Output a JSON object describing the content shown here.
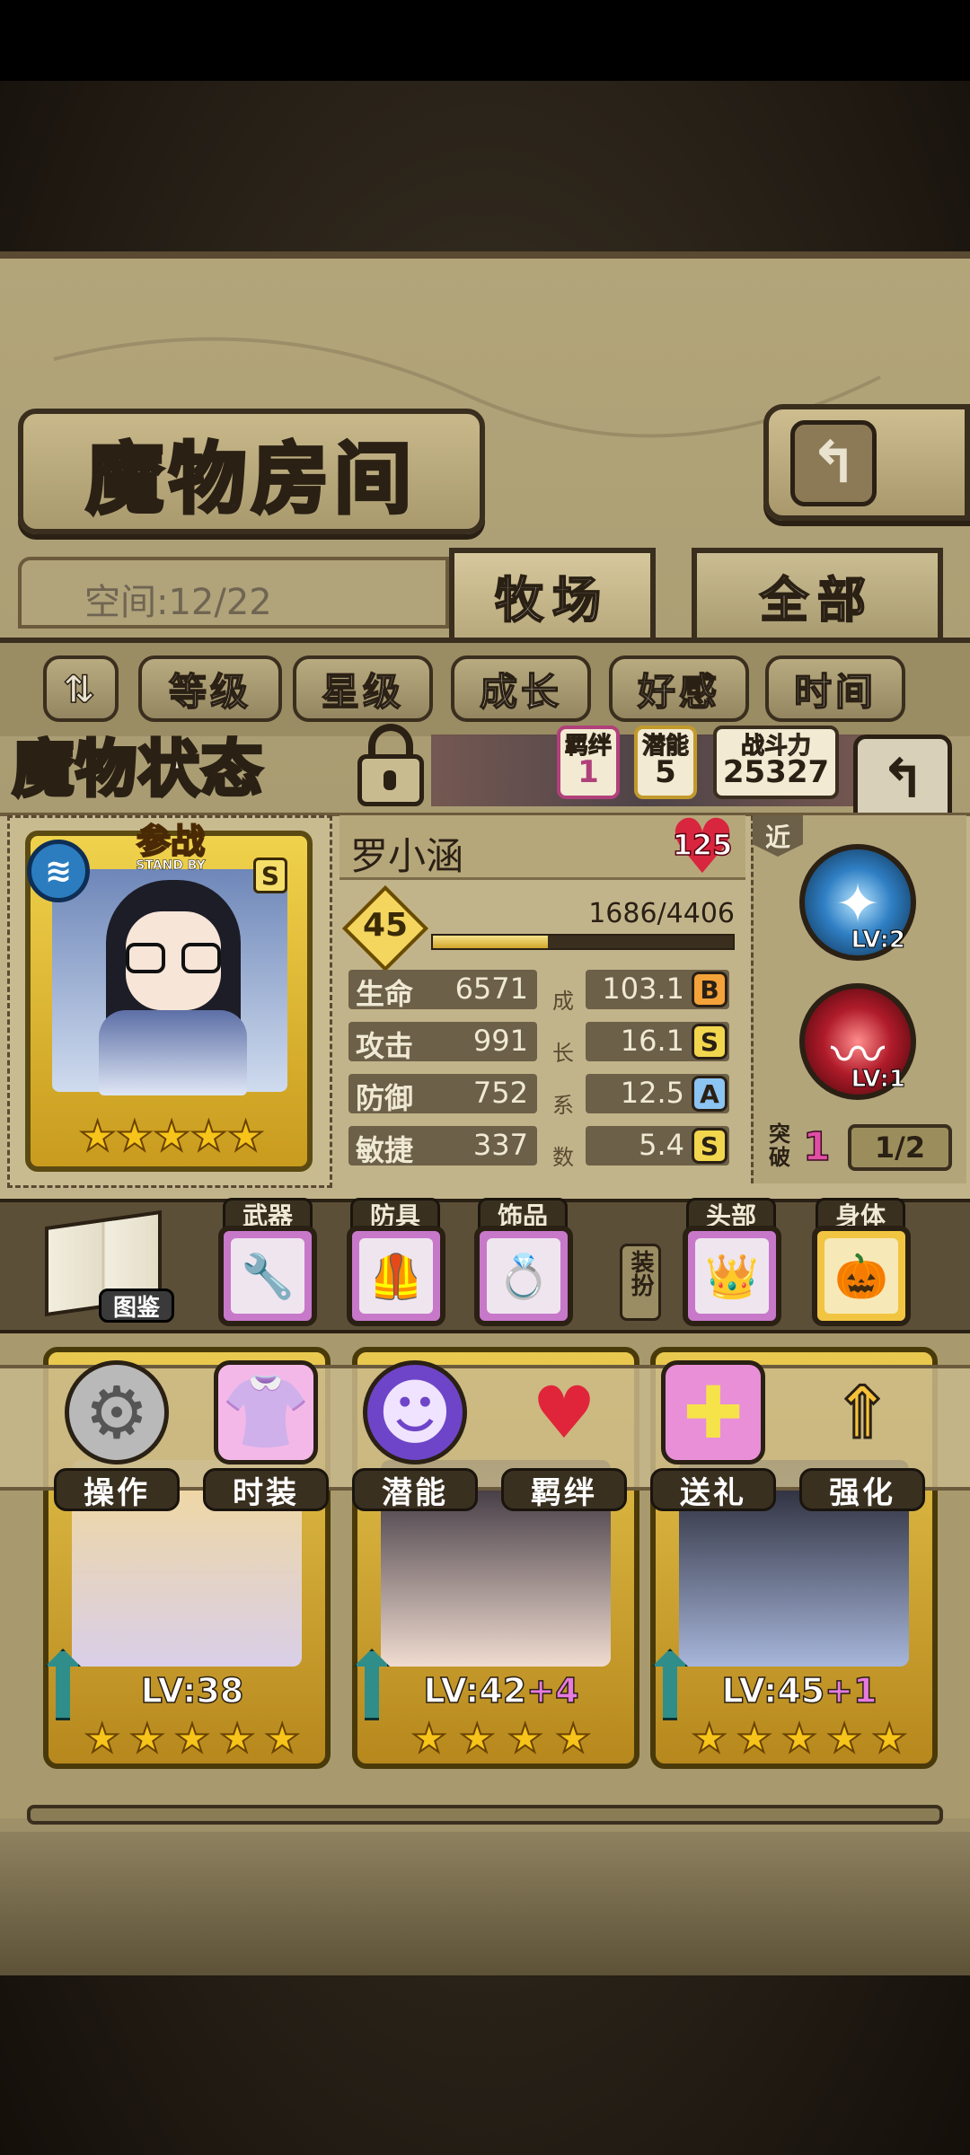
{
  "title": "魔物房间",
  "space": "空间:12/22",
  "tabs": [
    "牧场",
    "全部"
  ],
  "sort_buttons": [
    "等级",
    "星级",
    "成长",
    "好感",
    "时间"
  ],
  "status_title": "魔物状态",
  "mini_stats": {
    "bond": {
      "label": "羁绊",
      "value": "1"
    },
    "potential": {
      "label": "潜能",
      "value": "5"
    },
    "power": {
      "label": "战斗力",
      "value": "25327"
    }
  },
  "portrait": {
    "standby_cn": "参战",
    "standby_en": "STAND BY",
    "rank": "S",
    "stars": 5
  },
  "monster": {
    "name": "罗小涵",
    "affinity": "125",
    "level": "45",
    "exp_text": "1686/4406",
    "exp_ratio": 0.383
  },
  "stats": [
    {
      "label": "生命",
      "value": "6571",
      "growth": "103.1",
      "grade": "B"
    },
    {
      "label": "攻击",
      "value": "991",
      "growth": "16.1",
      "grade": "S"
    },
    {
      "label": "防御",
      "value": "752",
      "growth": "12.5",
      "grade": "A"
    },
    {
      "label": "敏捷",
      "value": "337",
      "growth": "5.4",
      "grade": "S"
    }
  ],
  "growth_vertical": [
    "成",
    "长",
    "系",
    "数"
  ],
  "skills": {
    "range_tag": "近",
    "skill1_lv": "LV:2",
    "skill2_lv": "LV:1"
  },
  "breakthrough": {
    "label": "突破",
    "count": "1",
    "progress": "1/2"
  },
  "equipment": {
    "book_label": "图鉴",
    "tags": [
      "武器",
      "防具",
      "饰品",
      "头部",
      "身体"
    ],
    "dress_label": "装扮"
  },
  "monster_cards": [
    {
      "level": "LV:38",
      "bonus": "",
      "stars": 5
    },
    {
      "level": "LV:42",
      "bonus": "+4",
      "stars": 4
    },
    {
      "level": "LV:45",
      "bonus": "+1",
      "stars": 5
    }
  ],
  "actions": [
    "操作",
    "时装",
    "潜能",
    "羁绊",
    "送礼",
    "强化"
  ]
}
